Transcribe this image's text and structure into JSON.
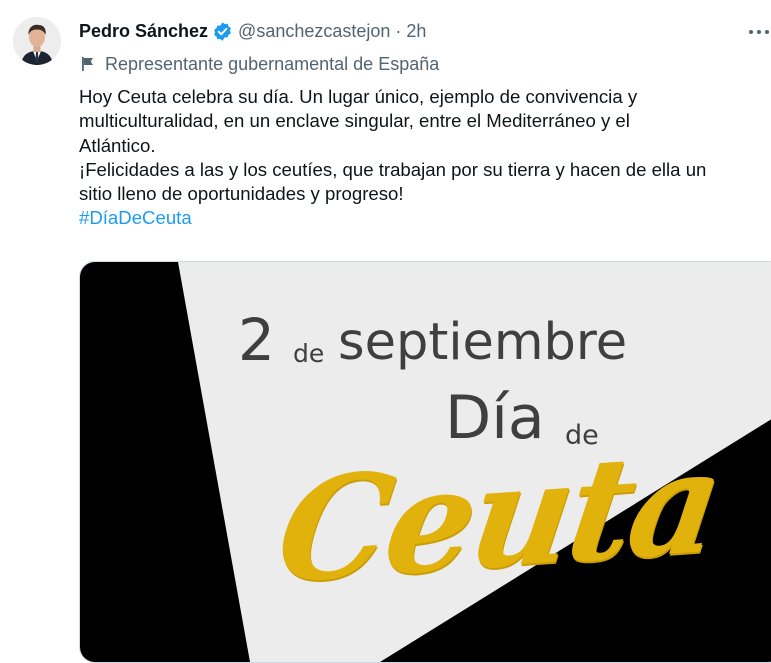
{
  "author": {
    "name": "Pedro Sánchez",
    "handle": "@sanchezcastejon",
    "separator": "·",
    "time": "2h",
    "label": "Representante gubernamental de España"
  },
  "tweet": {
    "lines": [
      "Hoy Ceuta celebra su día. Un lugar único, ejemplo de convivencia y",
      "multiculturalidad, en un enclave singular, entre el Mediterráneo y el",
      "Atlántico.",
      "¡Felicidades a las y los ceutíes, que trabajan por su tierra y hacen de ella un",
      "sitio lleno de oportunidades y progreso!"
    ],
    "hashtag": "#DíaDeCeuta"
  },
  "media": {
    "day": "2",
    "de_small": "de",
    "month": "septiembre",
    "dia": "Día",
    "de": "de",
    "city": "Ceuta",
    "colors": {
      "black": "#000000",
      "gray": "#ececec",
      "gold": "#e2b20c"
    }
  },
  "colors": {
    "accent": "#1d9bf0",
    "secondary_text": "#536471",
    "verified_badge": "#1d9bf0"
  },
  "icons": {
    "verified": "verified-badge-icon",
    "flag": "flag-icon",
    "more": "more-options-icon"
  }
}
